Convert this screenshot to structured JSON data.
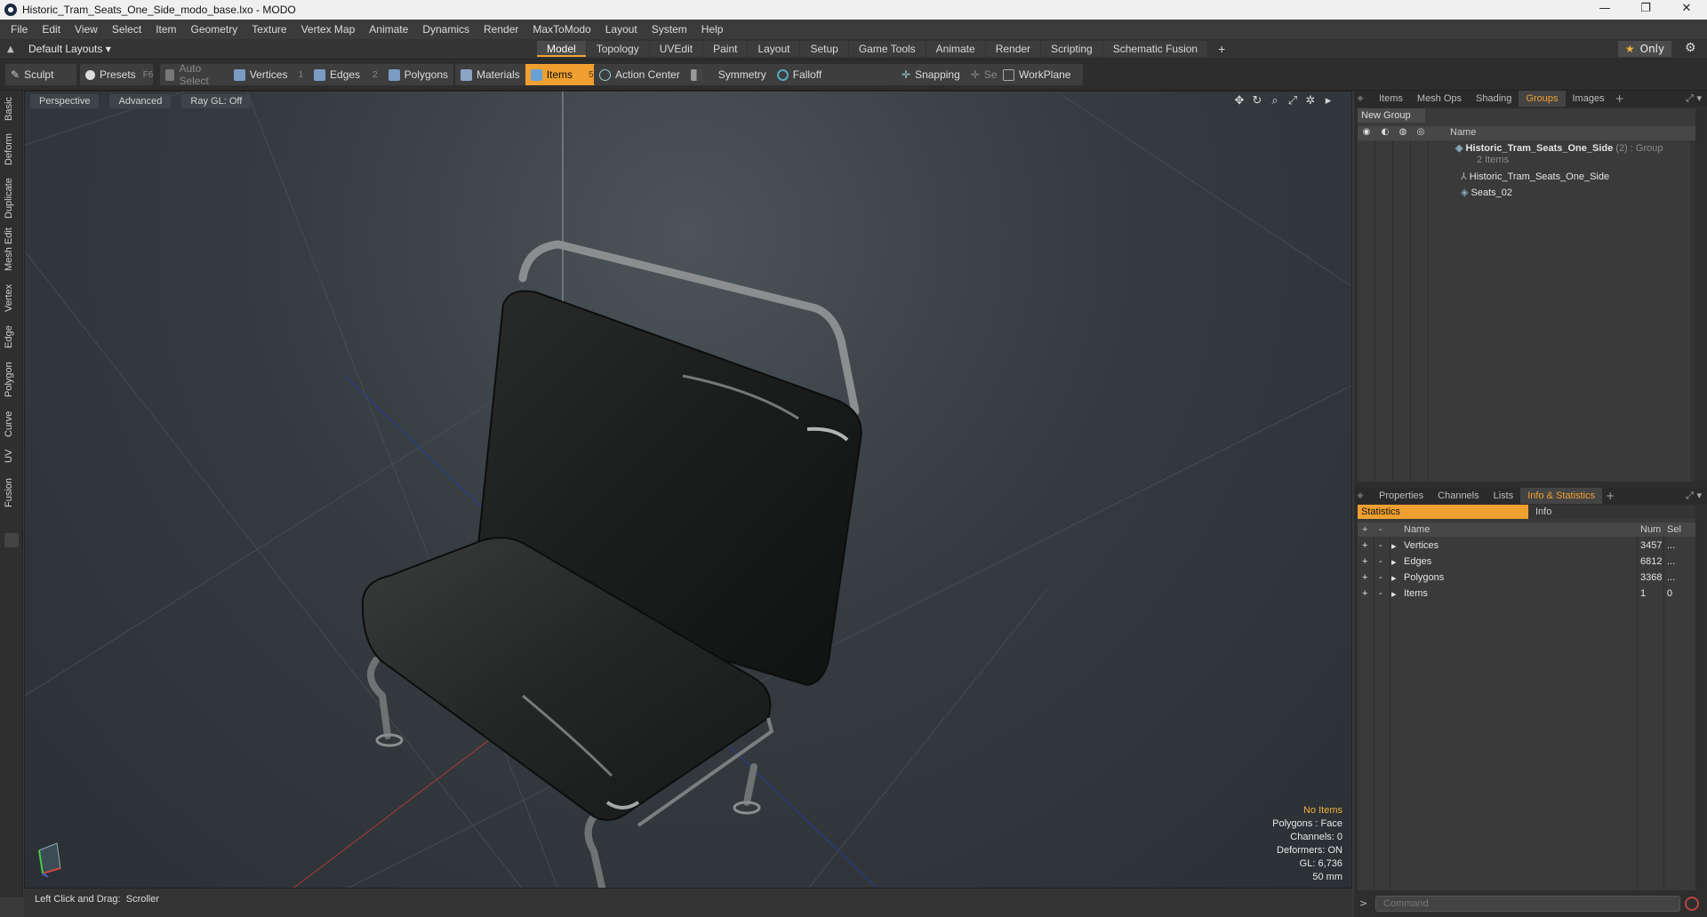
{
  "window": {
    "title": "Historic_Tram_Seats_One_Side_modo_base.lxo - MODO",
    "controls": [
      "—",
      "❐",
      "✕"
    ]
  },
  "menu": [
    "File",
    "Edit",
    "View",
    "Select",
    "Item",
    "Geometry",
    "Texture",
    "Vertex Map",
    "Animate",
    "Dynamics",
    "Render",
    "MaxToModo",
    "Layout",
    "System",
    "Help"
  ],
  "layoutbar": {
    "layouts_label": "Default Layouts ▾",
    "tabs": [
      "Model",
      "Topology",
      "UVEdit",
      "Paint",
      "Layout",
      "Setup",
      "Game Tools",
      "Animate",
      "Render",
      "Scripting",
      "Schematic Fusion"
    ],
    "active_tab": "Model",
    "add": "+",
    "only_label": "Only"
  },
  "toolbar": {
    "sculpt": "Sculpt",
    "presets": "Presets",
    "presets_key": "F6",
    "auto_select": "Auto Select",
    "vertices": "Vertices",
    "vertices_num": "1",
    "edges": "Edges",
    "edges_num": "2",
    "polygons": "Polygons",
    "materials": "Materials",
    "items": "Items",
    "items_num": "5",
    "action_center": "Action Center",
    "symmetry": "Symmetry",
    "falloff": "Falloff",
    "snapping": "Snapping",
    "select_through": "Select Through",
    "workplane": "WorkPlane",
    "colors": {
      "accent": "#f0a030"
    }
  },
  "left_tabs": [
    "Basic",
    "Deform",
    "Duplicate",
    "Mesh Edit",
    "Vertex",
    "Edge",
    "Polygon",
    "Curve",
    "UV",
    "Fusion"
  ],
  "viewport": {
    "view_mode": "Perspective",
    "shading": "Advanced",
    "raygl": "Ray GL: Off",
    "hud": {
      "selection": "No Items",
      "polygons": "Polygons : Face",
      "channels": "Channels: 0",
      "deformers": "Deformers: ON",
      "gl": "GL: 6,736",
      "lens": "50 mm"
    }
  },
  "status": {
    "hint_label": "Left Click and Drag:",
    "hint_action": "Scroller"
  },
  "groups_panel": {
    "tabs": [
      "Items",
      "Mesh Ops",
      "Shading",
      "Groups",
      "Images"
    ],
    "active_tab": "Groups",
    "new_group": "New Group",
    "col_name": "Name",
    "root": {
      "name": "Historic_Tram_Seats_One_Side",
      "count": "(2)",
      "type": ": Group",
      "sub": "2 Items"
    },
    "children": [
      "Historic_Tram_Seats_One_Side",
      "Seats_02"
    ]
  },
  "stats_panel": {
    "tabs": [
      "Properties",
      "Channels",
      "Lists",
      "Info & Statistics"
    ],
    "active_tab": "Info & Statistics",
    "subtabs": [
      "Statistics",
      "Info"
    ],
    "headers": {
      "plus": "+",
      "minus": "-",
      "name": "Name",
      "num": "Num",
      "sel": "Sel"
    },
    "rows": [
      {
        "name": "Vertices",
        "num": "3457",
        "sel": "..."
      },
      {
        "name": "Edges",
        "num": "6812",
        "sel": "..."
      },
      {
        "name": "Polygons",
        "num": "3368",
        "sel": "..."
      },
      {
        "name": "Items",
        "num": "1",
        "sel": "0"
      }
    ]
  },
  "command": {
    "prompt": ">",
    "placeholder": "Command"
  }
}
